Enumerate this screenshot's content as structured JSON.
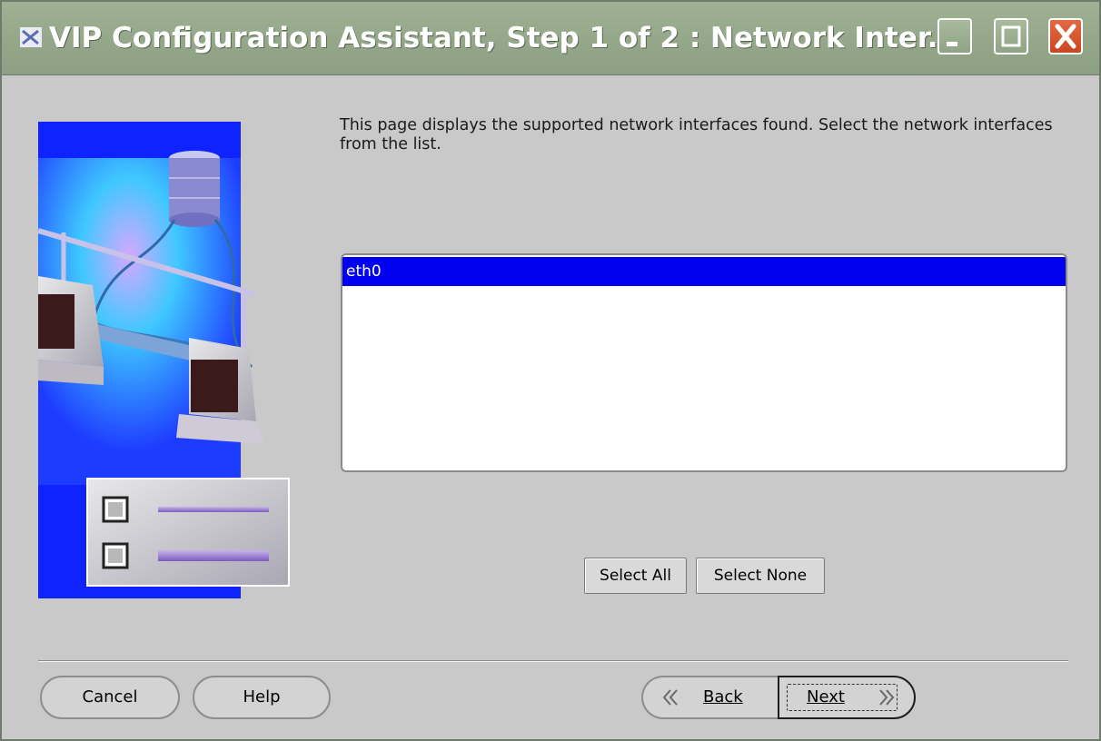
{
  "window": {
    "title": "VIP Configuration Assistant, Step 1 of 2 : Network Inter...",
    "buttons": {
      "minimize": "minimize-icon",
      "maximize": "maximize-icon",
      "close": "close-icon"
    },
    "colors": {
      "titlebar": "#9fb193",
      "background": "#c9c9c9",
      "selection": "#0000ee"
    }
  },
  "content": {
    "instructions": "This page displays the supported network interfaces found. Select the network interfaces from the list.",
    "interfaces": [
      {
        "name": "eth0",
        "selected": true
      }
    ]
  },
  "actions": {
    "select_all": "Select All",
    "select_none": "Select None"
  },
  "footer": {
    "cancel": "Cancel",
    "help": "Help",
    "back": "Back",
    "next": "Next"
  }
}
